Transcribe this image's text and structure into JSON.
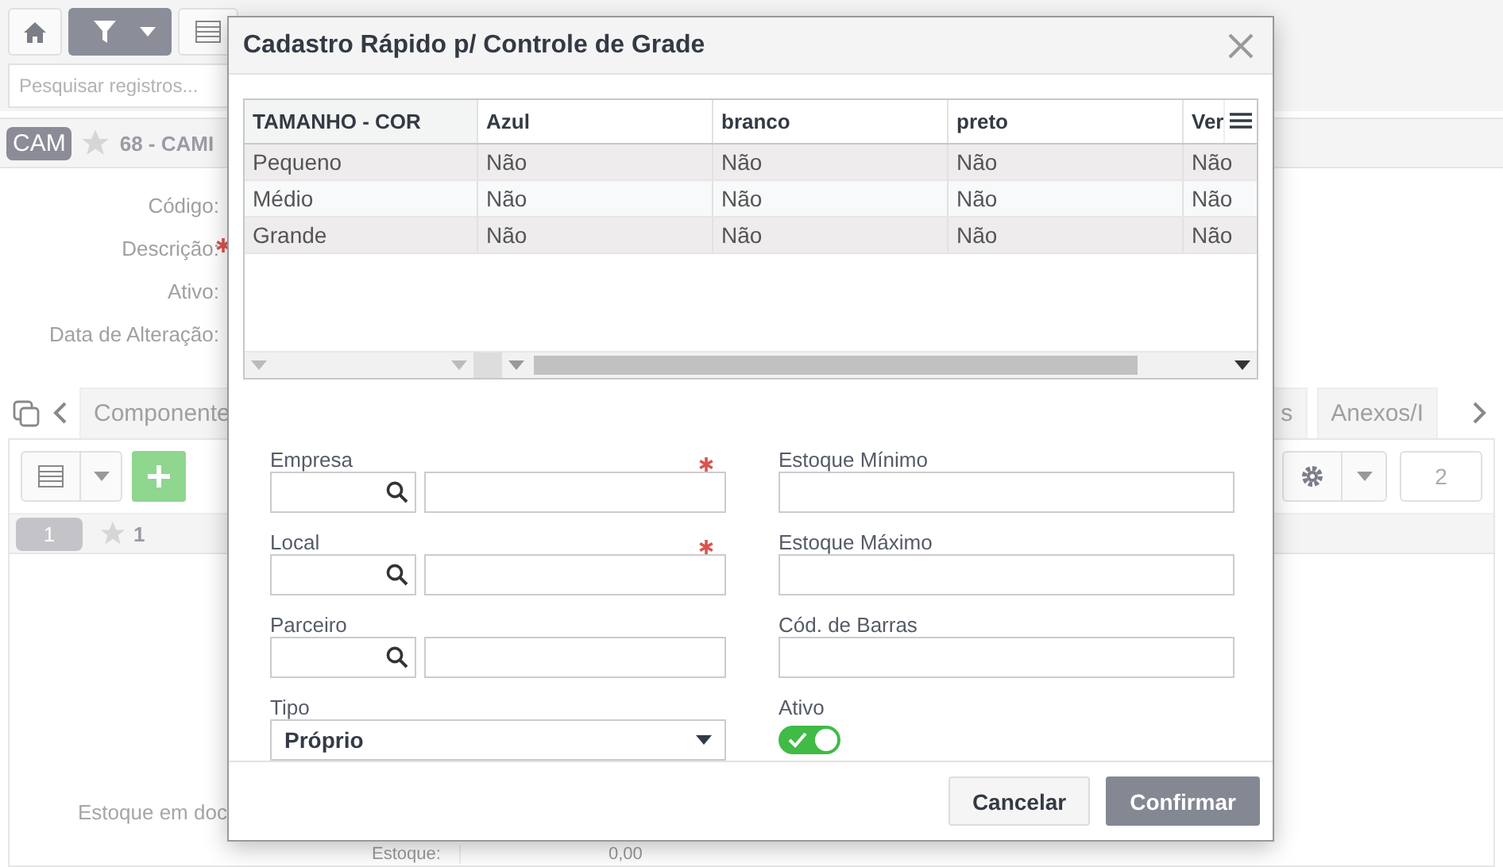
{
  "page": {
    "search": {
      "placeholder": "Pesquisar registros..."
    },
    "record": {
      "badge": "CAM",
      "title": "68 - CAMI"
    },
    "fields": [
      {
        "label": "Código:",
        "required": false
      },
      {
        "label": "Descrição:",
        "required": true
      },
      {
        "label": "Ativo:",
        "required": false
      },
      {
        "label": "Data de Alteração:",
        "required": false
      }
    ],
    "tabs_left": [
      {
        "label": "Componente",
        "selected": false
      }
    ],
    "tabs_right": [
      {
        "label": "s",
        "selected": false
      },
      {
        "label": "Anexos/I",
        "selected": false
      }
    ],
    "counter": "2",
    "list_row": {
      "badge": "1",
      "favorites": "1"
    },
    "bottom_label": "Estoque em doc",
    "stock": {
      "label": "Estoque:",
      "value": "0,00"
    }
  },
  "dialog": {
    "title": "Cadastro Rápido p/ Controle de Grade",
    "grid": {
      "columns": [
        "TAMANHO - COR",
        "Azul",
        "branco",
        "preto",
        "Ver"
      ],
      "rows": [
        {
          "cells": [
            "Pequeno",
            "Não",
            "Não",
            "Não",
            "Não"
          ]
        },
        {
          "cells": [
            "Médio",
            "Não",
            "Não",
            "Não",
            "Não"
          ]
        },
        {
          "cells": [
            "Grande",
            "Não",
            "Não",
            "Não",
            "Não"
          ]
        }
      ]
    },
    "form_left": [
      {
        "kind": "lookup",
        "label": "Empresa",
        "required": true
      },
      {
        "kind": "lookup",
        "label": "Local",
        "required": true
      },
      {
        "kind": "lookup",
        "label": "Parceiro",
        "required": false
      },
      {
        "kind": "select",
        "label": "Tipo",
        "value": "Próprio",
        "required": false
      }
    ],
    "form_right": [
      {
        "kind": "text",
        "label": "Estoque Mínimo"
      },
      {
        "kind": "text",
        "label": "Estoque Máximo"
      },
      {
        "kind": "text",
        "label": "Cód. de Barras"
      },
      {
        "kind": "toggle",
        "label": "Ativo",
        "on": true
      }
    ],
    "buttons": [
      {
        "label": "Cancelar",
        "kind": "secondary"
      },
      {
        "label": "Confirmar",
        "kind": "primary"
      }
    ]
  }
}
